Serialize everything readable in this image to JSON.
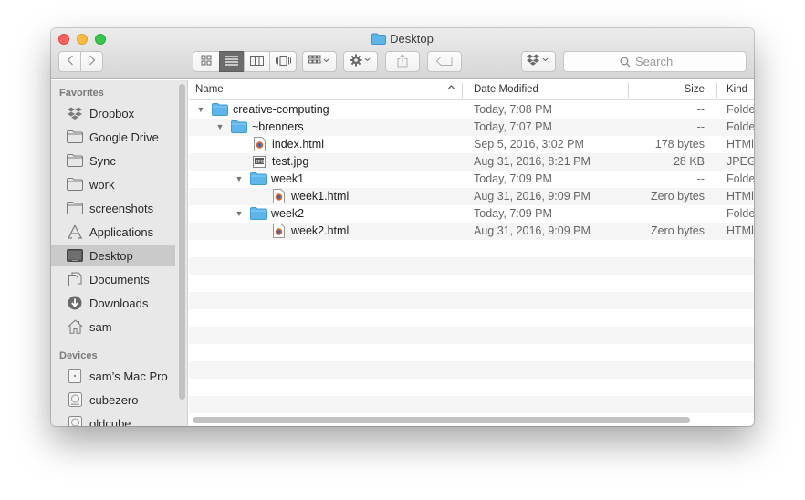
{
  "window": {
    "title": "Desktop"
  },
  "toolbar": {
    "nav": {
      "back_icon": "chevron-left-icon",
      "forward_icon": "chevron-right-icon"
    },
    "views": [
      "icon-view-icon",
      "list-view-icon",
      "column-view-icon",
      "coverflow-view-icon"
    ],
    "active_view": "list",
    "search_placeholder": "Search"
  },
  "sidebar": {
    "favorites_heading": "Favorites",
    "favorites": [
      {
        "label": "Dropbox",
        "icon": "dropbox-icon"
      },
      {
        "label": "Google Drive",
        "icon": "folder-icon"
      },
      {
        "label": "Sync",
        "icon": "folder-icon"
      },
      {
        "label": "work",
        "icon": "folder-icon"
      },
      {
        "label": "screenshots",
        "icon": "folder-icon"
      },
      {
        "label": "Applications",
        "icon": "applications-icon"
      },
      {
        "label": "Desktop",
        "icon": "desktop-icon",
        "selected": true
      },
      {
        "label": "Documents",
        "icon": "documents-icon"
      },
      {
        "label": "Downloads",
        "icon": "downloads-icon"
      },
      {
        "label": "sam",
        "icon": "home-icon"
      }
    ],
    "devices_heading": "Devices",
    "devices": [
      {
        "label": "sam’s Mac Pro",
        "icon": "computer-icon"
      },
      {
        "label": "cubezero",
        "icon": "disk-icon"
      },
      {
        "label": "oldcube",
        "icon": "disk-icon"
      }
    ]
  },
  "columns": {
    "name": "Name",
    "date": "Date Modified",
    "size": "Size",
    "kind": "Kind"
  },
  "files": [
    {
      "name": "creative-computing",
      "date": "Today, 7:08 PM",
      "size": "--",
      "kind": "Folde",
      "depth": 0,
      "type": "folder",
      "expanded": true
    },
    {
      "name": "~brenners",
      "date": "Today, 7:07 PM",
      "size": "--",
      "kind": "Folde",
      "depth": 1,
      "type": "folder",
      "expanded": true
    },
    {
      "name": "index.html",
      "date": "Sep 5, 2016, 3:02 PM",
      "size": "178 bytes",
      "kind": "HTMl",
      "depth": 2,
      "type": "html"
    },
    {
      "name": "test.jpg",
      "date": "Aug 31, 2016, 8:21 PM",
      "size": "28 KB",
      "kind": "JPEG",
      "depth": 2,
      "type": "jpg"
    },
    {
      "name": "week1",
      "date": "Today, 7:09 PM",
      "size": "--",
      "kind": "Folde",
      "depth": 2,
      "type": "folder",
      "expanded": true
    },
    {
      "name": "week1.html",
      "date": "Aug 31, 2016, 9:09 PM",
      "size": "Zero bytes",
      "kind": "HTMl",
      "depth": 3,
      "type": "html"
    },
    {
      "name": "week2",
      "date": "Today, 7:09 PM",
      "size": "--",
      "kind": "Folde",
      "depth": 2,
      "type": "folder",
      "expanded": true
    },
    {
      "name": "week2.html",
      "date": "Aug 31, 2016, 9:09 PM",
      "size": "Zero bytes",
      "kind": "HTMl",
      "depth": 3,
      "type": "html"
    }
  ],
  "colors": {
    "folder": "#5eb5ea",
    "selection": "#cacaca",
    "stripe": "#f5f5f5"
  }
}
